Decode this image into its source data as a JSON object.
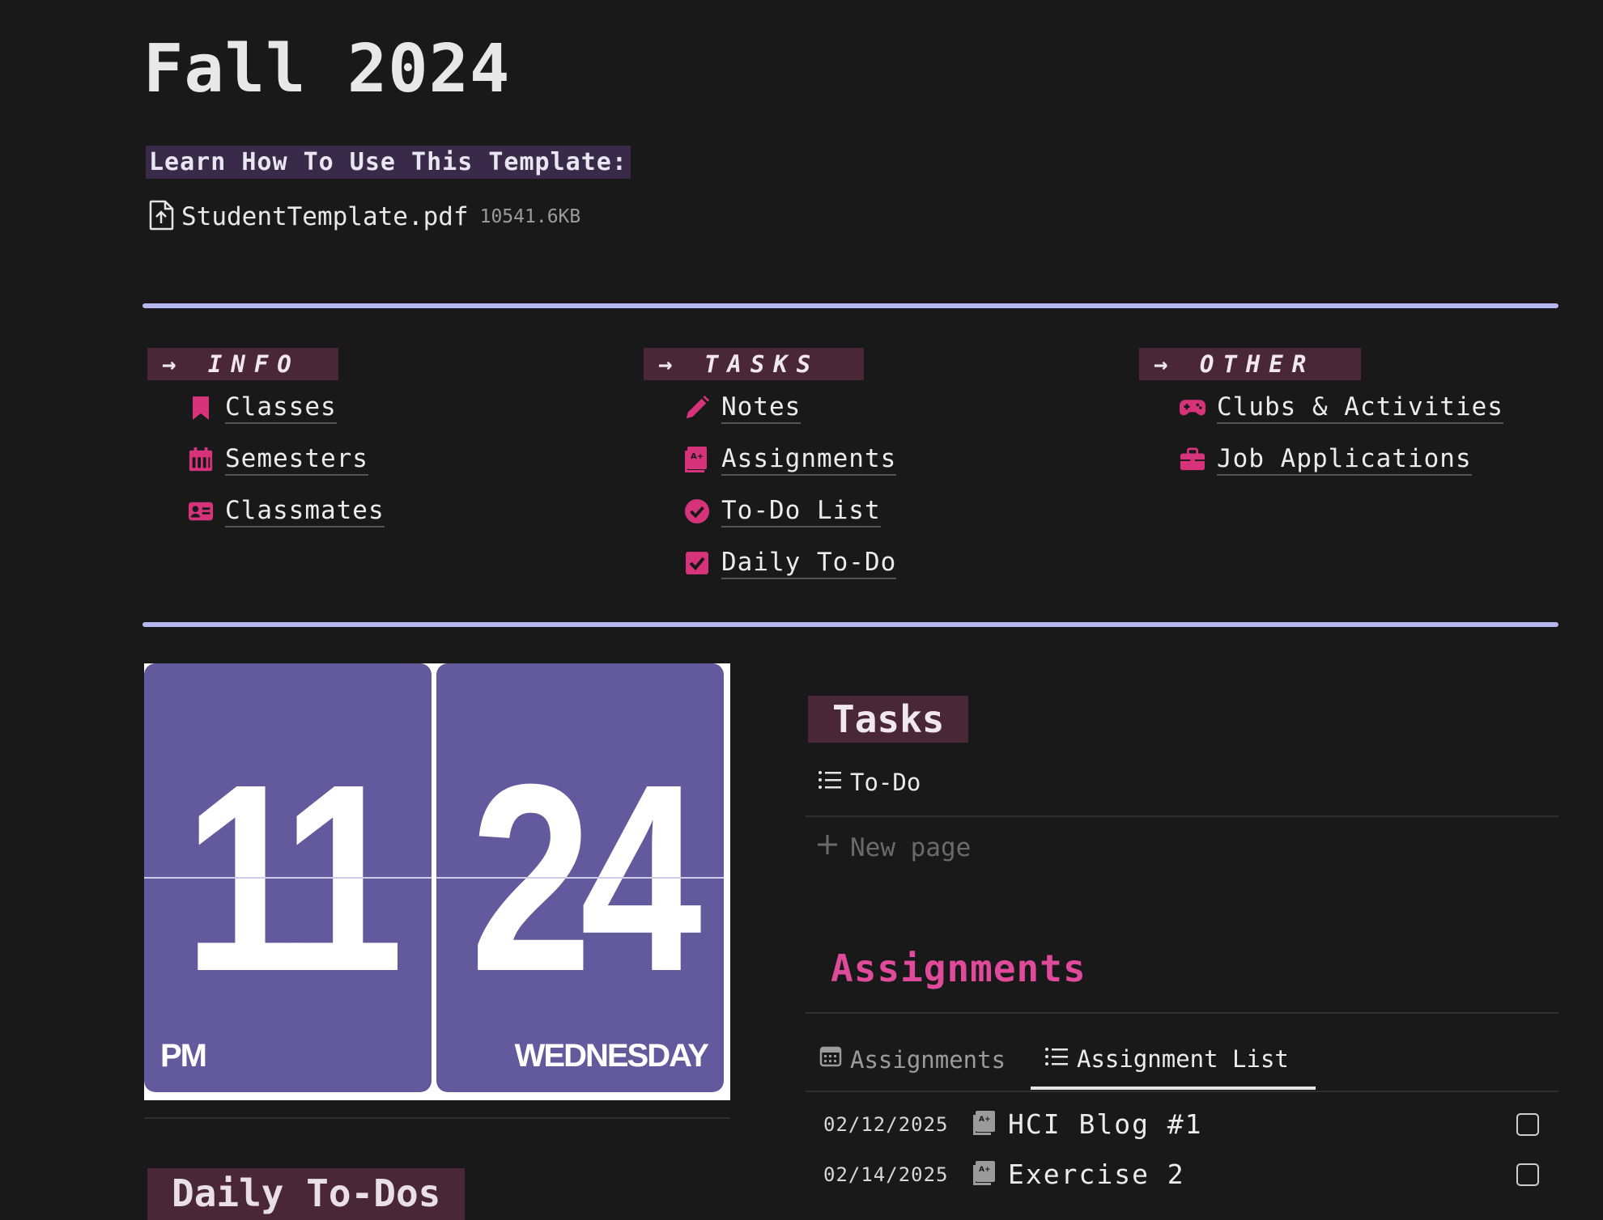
{
  "page": {
    "title": "Fall 2024"
  },
  "template_info": {
    "learn_label": "Learn How To Use This Template:",
    "file_name": "StudentTemplate.pdf",
    "file_size": "10541.6KB"
  },
  "columns": [
    {
      "heading": "→ INFO",
      "items": [
        {
          "label": "Classes",
          "icon": "bookmark-icon"
        },
        {
          "label": "Semesters",
          "icon": "calendar-icon"
        },
        {
          "label": "Classmates",
          "icon": "id-card-icon"
        }
      ]
    },
    {
      "heading": "→ TASKS",
      "items": [
        {
          "label": "Notes",
          "icon": "pencil-icon"
        },
        {
          "label": "Assignments",
          "icon": "assignment-icon"
        },
        {
          "label": "To-Do List",
          "icon": "check-circle-icon"
        },
        {
          "label": "Daily To-Do",
          "icon": "checkbox-icon"
        }
      ]
    },
    {
      "heading": "→ OTHER",
      "items": [
        {
          "label": "Clubs & Activities",
          "icon": "gamepad-icon"
        },
        {
          "label": "Job Applications",
          "icon": "briefcase-icon"
        }
      ]
    }
  ],
  "clock": {
    "hour": "11",
    "minute": "24",
    "period": "PM",
    "day": "WEDNESDAY",
    "color": "#635a9e"
  },
  "tasks_section": {
    "heading": "Tasks",
    "view_label": "To-Do",
    "new_page": "New page"
  },
  "assignments_section": {
    "heading": "Assignments",
    "tabs": [
      {
        "label": "Assignments",
        "icon": "calendar-grid-icon",
        "active": false
      },
      {
        "label": "Assignment List",
        "icon": "list-icon",
        "active": true
      }
    ],
    "rows": [
      {
        "date": "02/12/2025",
        "name": "HCI Blog #1",
        "checked": false
      },
      {
        "date": "02/14/2025",
        "name": "Exercise 2",
        "checked": false
      }
    ]
  },
  "daily_section": {
    "heading": "Daily To-Dos"
  },
  "colors": {
    "accent_pink": "#d6337a",
    "divider": "#b7b8f0",
    "heading_bg": "#4a2737",
    "background": "#191919"
  }
}
